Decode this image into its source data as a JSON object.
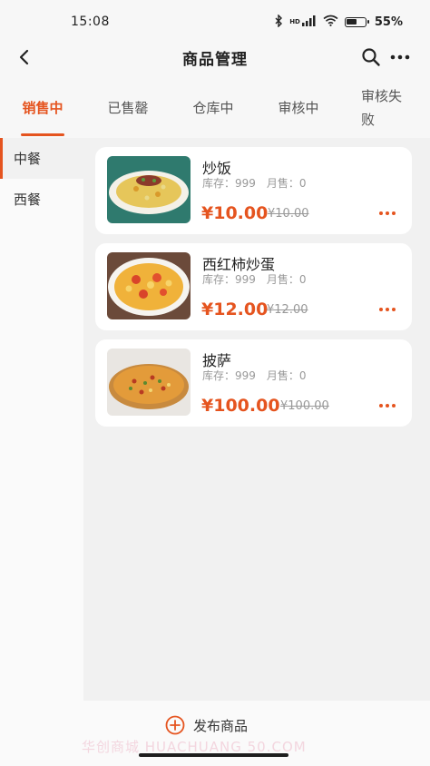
{
  "status": {
    "time": "15:08",
    "network": "HD",
    "battery": "55%"
  },
  "header": {
    "title": "商品管理"
  },
  "tabs": [
    {
      "label": "销售中"
    },
    {
      "label": "已售罄"
    },
    {
      "label": "仓库中"
    },
    {
      "label": "审核中"
    },
    {
      "label": "审核失败"
    }
  ],
  "sidebar": {
    "items": [
      {
        "label": "中餐"
      },
      {
        "label": "西餐"
      }
    ]
  },
  "products": [
    {
      "name": "炒饭",
      "stock": "库存：999　月售：0",
      "price": "¥10.00",
      "original_price": "¥10.00"
    },
    {
      "name": "西红柿炒蛋",
      "stock": "库存：999　月售：0",
      "price": "¥12.00",
      "original_price": "¥12.00"
    },
    {
      "name": "披萨",
      "stock": "库存：999　月售：0",
      "price": "¥100.00",
      "original_price": "¥100.00"
    }
  ],
  "footer": {
    "publish_label": "发布商品",
    "watermark": "华创商城 HUACHUANG 50.COM"
  },
  "colors": {
    "accent": "#e5541f",
    "background": "#f4f4f4"
  }
}
